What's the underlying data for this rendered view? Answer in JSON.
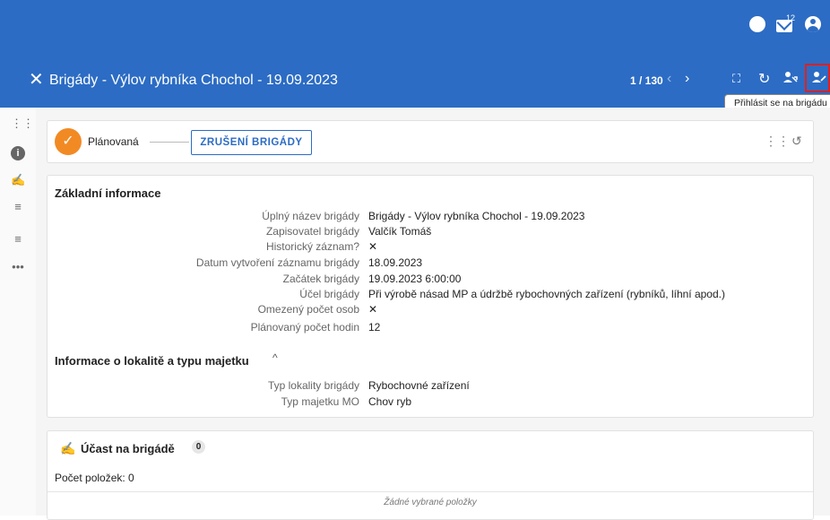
{
  "topbar": {
    "add_icon": "circle-plus-icon",
    "notifications_icon": "mail-icon",
    "notifications_count": "12",
    "user_icon": "user-circle-icon"
  },
  "header": {
    "close_icon": "close-icon",
    "title": "Brigády - Výlov rybníka Chochol - 19.09.2023",
    "pager": "1 / 130",
    "tools": [
      "expand-icon",
      "refresh-icon",
      "assign-person-icon",
      "signup-person-icon"
    ],
    "tooltip": "Přihlásit se na brigádu"
  },
  "sidebar": {
    "icons": [
      "workflow-icon",
      "info-icon",
      "participation-icon",
      "list-icon",
      "list-icon",
      "more-icon"
    ]
  },
  "status": {
    "check_icon": "check-icon",
    "label": "Plánovaná",
    "cancel_button": "ZRUŠENÍ BRIGÁDY",
    "tools": [
      "workflow-icon",
      "history-icon"
    ]
  },
  "basic_info": {
    "title": "Základní informace",
    "rows": [
      {
        "label": "Úplný název brigády",
        "value": "Brigády - Výlov rybníka Chochol - 19.09.2023"
      },
      {
        "label": "Zapisovatel brigády",
        "value": "Valčík Tomáš"
      },
      {
        "label": "Historický záznam?",
        "value": "✕"
      },
      {
        "label": "Datum vytvoření záznamu brigády",
        "value": "18.09.2023"
      },
      {
        "label": "Začátek brigády",
        "value": "19.09.2023 6:00:00"
      },
      {
        "label": "Účel brigády",
        "value": "Při výrobě násad MP a údržbě rybochovných zařízení (rybníků, líhní apod.)"
      },
      {
        "label": "Omezený počet osob",
        "value": "✕"
      },
      {
        "label": "Plánovaný počet hodin",
        "value": "12"
      }
    ]
  },
  "location_info": {
    "title": "Informace o lokalitě a typu majetku",
    "rows": [
      {
        "label": "Typ lokality brigády",
        "value": "Rybochovné zařízení"
      },
      {
        "label": "Typ majetku MO",
        "value": "Chov ryb"
      }
    ]
  },
  "participation": {
    "title": "Účast na brigádě",
    "count": "0",
    "items_count": "Počet položek: 0",
    "empty": "Žádné vybrané položky"
  }
}
